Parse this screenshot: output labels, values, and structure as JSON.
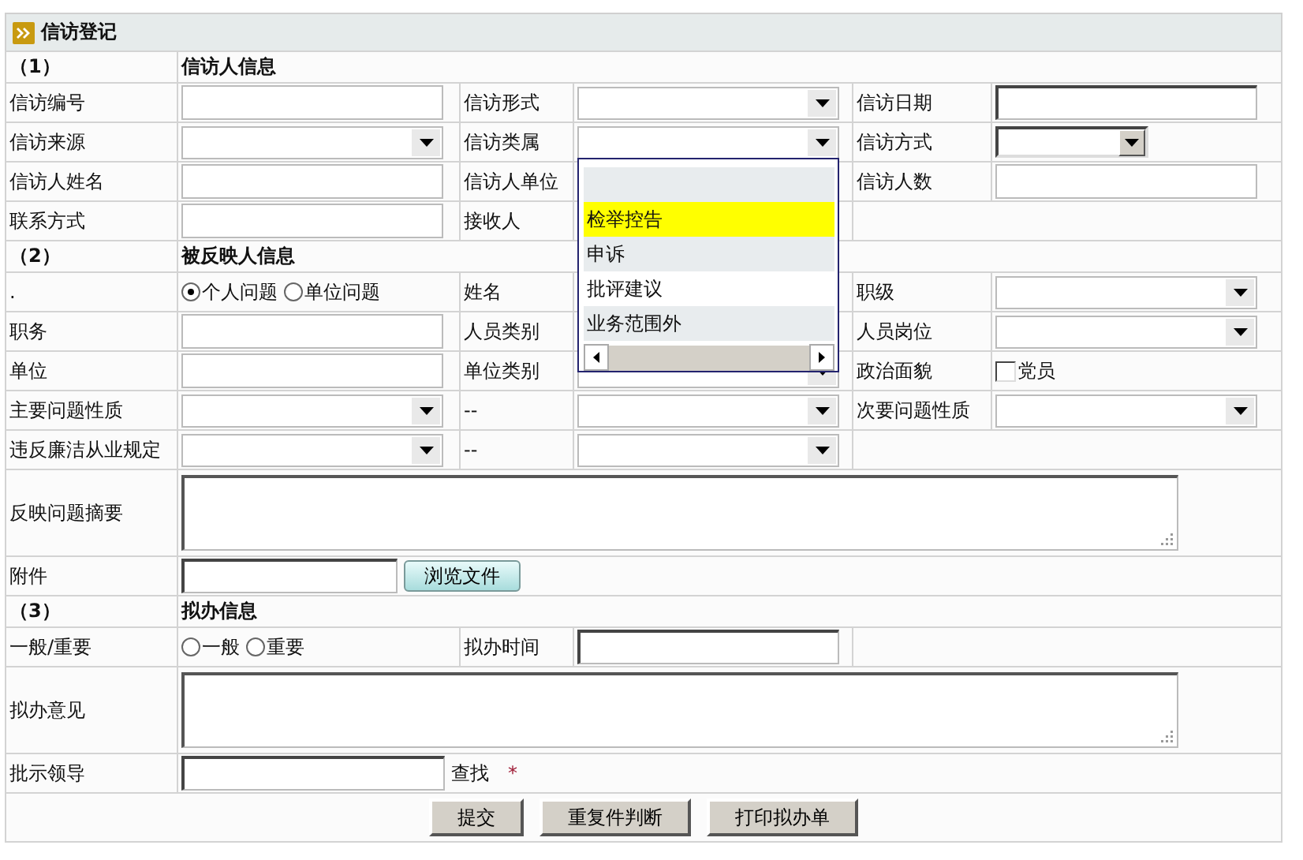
{
  "title": "信访登记",
  "rows": [
    {
      "kind": "section",
      "number": "（1）",
      "heading": "信访人信息"
    },
    {
      "kind": "fields",
      "pairs": [
        {
          "label": "信访编号",
          "field": {
            "kind": "text"
          }
        },
        {
          "label": "信访形式",
          "field": {
            "kind": "select"
          }
        },
        {
          "label": "信访日期",
          "field": {
            "kind": "text",
            "inset": true
          }
        }
      ]
    },
    {
      "kind": "fields",
      "pairs": [
        {
          "label": "信访来源",
          "field": {
            "kind": "select"
          }
        },
        {
          "label": "信访类属",
          "field": {
            "kind": "select",
            "open": true,
            "options": [
              {
                "label": "检举控告",
                "selected": true
              },
              {
                "label": "申诉",
                "selected": false
              },
              {
                "label": "批评建议",
                "selected": false
              },
              {
                "label": "业务范围外",
                "selected": false
              }
            ]
          }
        },
        {
          "label": "信访方式",
          "field": {
            "kind": "combo"
          }
        }
      ]
    },
    {
      "kind": "fields",
      "pairs": [
        {
          "label": "信访人姓名",
          "field": {
            "kind": "text"
          }
        },
        {
          "label": "信访人单位"
        },
        {
          "label": "信访人数",
          "field": {
            "kind": "text"
          }
        }
      ]
    },
    {
      "kind": "fields",
      "pairs": [
        {
          "label": "联系方式",
          "field": {
            "kind": "text"
          }
        },
        {
          "label": "接收人"
        }
      ]
    },
    {
      "kind": "section",
      "number": "（2）",
      "heading": "被反映人信息"
    },
    {
      "kind": "fields",
      "pairs": [
        {
          "label": ".",
          "field": {
            "kind": "radio",
            "options": [
              {
                "label": "个人问题",
                "selected": true
              },
              {
                "label": "单位问题",
                "selected": false
              }
            ]
          }
        },
        {
          "label": "姓名"
        },
        {
          "label": "职级",
          "field": {
            "kind": "select"
          }
        }
      ]
    },
    {
      "kind": "fields",
      "pairs": [
        {
          "label": "职务",
          "field": {
            "kind": "text"
          }
        },
        {
          "label": "人员类别"
        },
        {
          "label": "人员岗位",
          "field": {
            "kind": "select"
          }
        }
      ]
    },
    {
      "kind": "fields",
      "pairs": [
        {
          "label": "单位",
          "field": {
            "kind": "text"
          }
        },
        {
          "label": "单位类别",
          "field": {
            "kind": "select"
          }
        },
        {
          "label": "政治面貌",
          "field": {
            "kind": "checkbox",
            "label": "党员",
            "checked": false
          }
        }
      ]
    },
    {
      "kind": "fields",
      "pairs": [
        {
          "label": "主要问题性质",
          "field": {
            "kind": "select"
          }
        },
        {
          "label": "--",
          "field": {
            "kind": "select"
          }
        },
        {
          "label": "次要问题性质",
          "field": {
            "kind": "select"
          }
        }
      ]
    },
    {
      "kind": "fields",
      "pairs": [
        {
          "label": "违反廉洁从业规定",
          "field": {
            "kind": "select"
          }
        },
        {
          "label": "--",
          "field": {
            "kind": "select"
          }
        }
      ]
    },
    {
      "kind": "fields",
      "pairs": [
        {
          "label": "反映问题摘要",
          "field": {
            "kind": "textarea"
          }
        }
      ]
    },
    {
      "kind": "fields",
      "pairs": [
        {
          "label": "附件",
          "field": {
            "kind": "file",
            "button": "浏览文件"
          }
        }
      ]
    },
    {
      "kind": "section",
      "number": "（3）",
      "heading": "拟办信息"
    },
    {
      "kind": "fields",
      "pairs": [
        {
          "label": "一般/重要",
          "field": {
            "kind": "radio",
            "options": [
              {
                "label": "一般",
                "selected": false
              },
              {
                "label": "重要",
                "selected": false
              }
            ]
          }
        },
        {
          "label": "拟办时间",
          "field": {
            "kind": "text",
            "inset": true
          }
        }
      ]
    },
    {
      "kind": "fields",
      "pairs": [
        {
          "label": "拟办意见",
          "field": {
            "kind": "textarea"
          }
        }
      ]
    },
    {
      "kind": "fields",
      "pairs": [
        {
          "label": "批示领导",
          "field": {
            "kind": "lookup",
            "link": "查找",
            "required": "*"
          }
        }
      ]
    }
  ],
  "buttons": [
    "提交",
    "重复件判断",
    "打印拟办单"
  ]
}
